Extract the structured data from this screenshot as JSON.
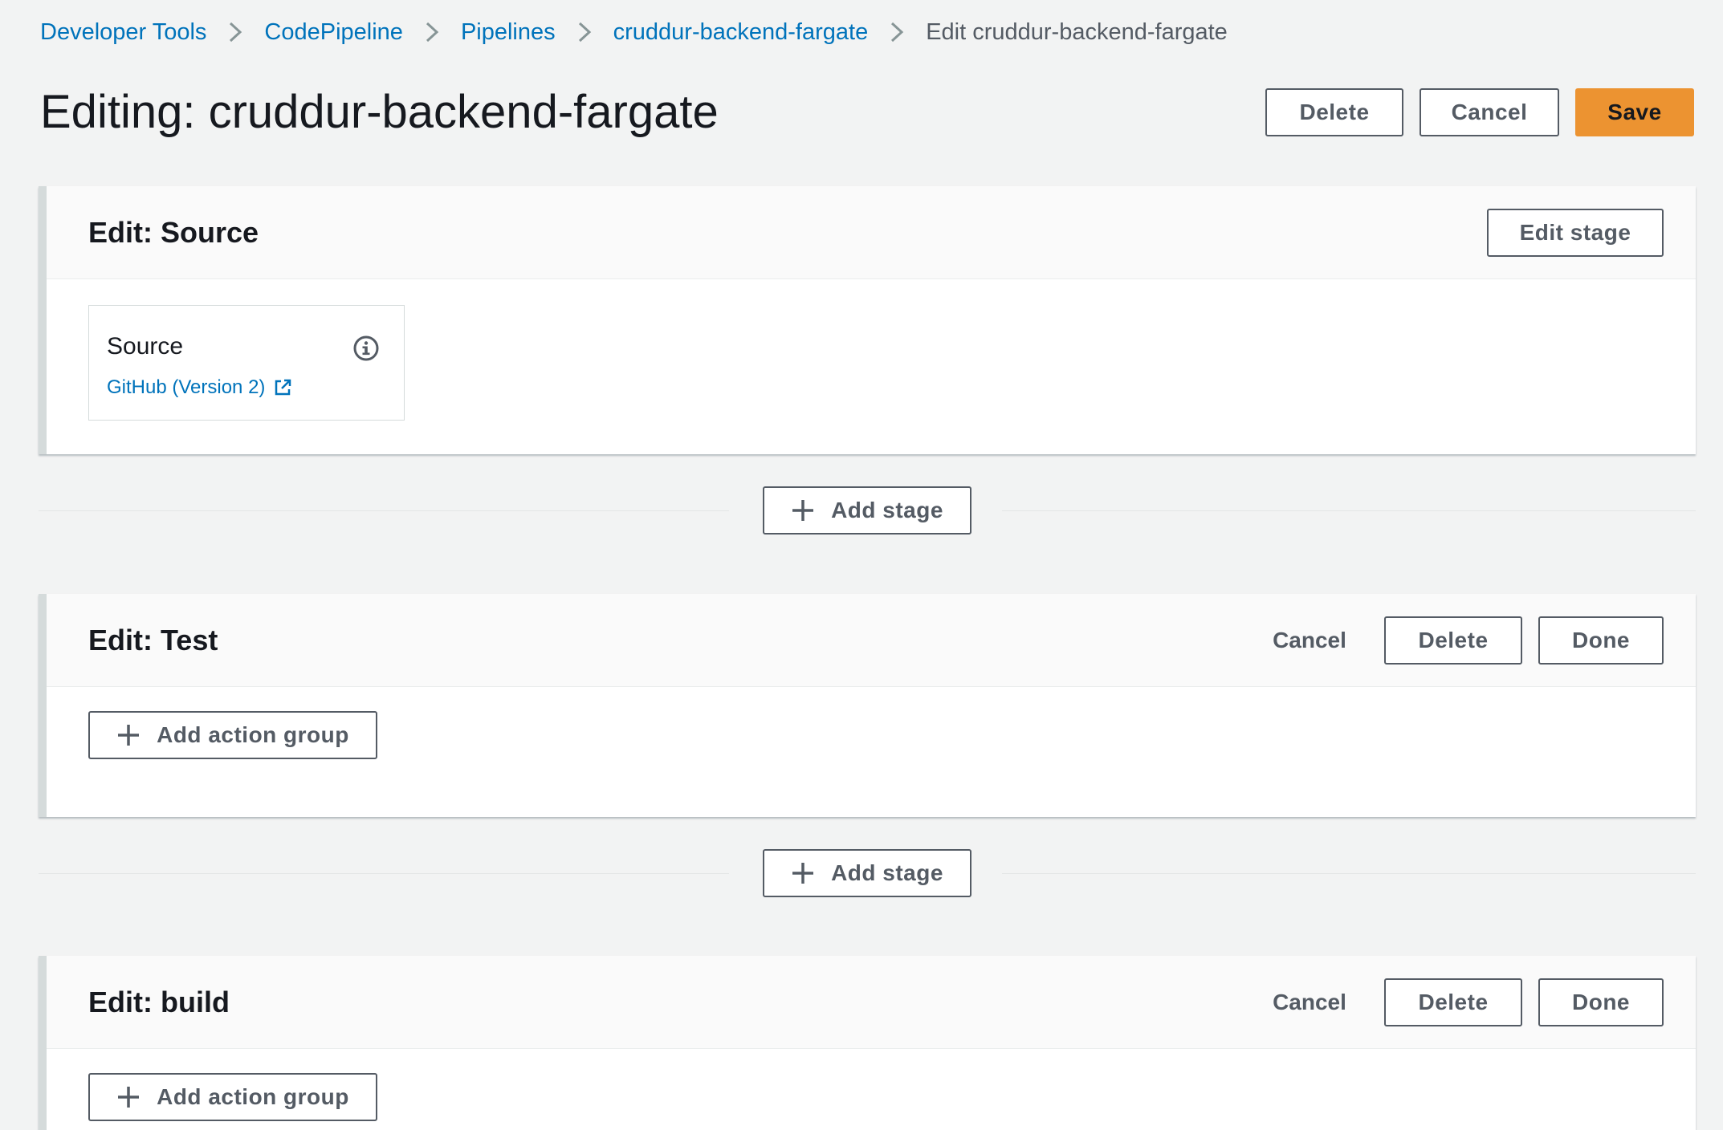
{
  "breadcrumb": {
    "items": [
      {
        "label": "Developer Tools"
      },
      {
        "label": "CodePipeline"
      },
      {
        "label": "Pipelines"
      },
      {
        "label": "cruddur-backend-fargate"
      }
    ],
    "current": "Edit cruddur-backend-fargate"
  },
  "header": {
    "title": "Editing: cruddur-backend-fargate",
    "delete_label": "Delete",
    "cancel_label": "Cancel",
    "save_label": "Save"
  },
  "stages": [
    {
      "title": "Edit: Source",
      "edit_stage_label": "Edit stage",
      "action": {
        "name": "Source",
        "provider": "GitHub (Version 2)",
        "info_icon": "info-icon",
        "external_icon": "external-link-icon"
      }
    },
    {
      "title": "Edit: Test",
      "cancel_label": "Cancel",
      "delete_label": "Delete",
      "done_label": "Done",
      "add_action_group_label": "Add action group"
    },
    {
      "title": "Edit: build",
      "cancel_label": "Cancel",
      "delete_label": "Delete",
      "done_label": "Done",
      "add_action_group_label": "Add action group"
    }
  ],
  "add_stage_label": "Add stage",
  "colors": {
    "background": "#f2f3f3",
    "link": "#0073bb",
    "primary_button": "#ec9331",
    "button_text": "#545b64",
    "stage_border": "#d5dbdb"
  }
}
